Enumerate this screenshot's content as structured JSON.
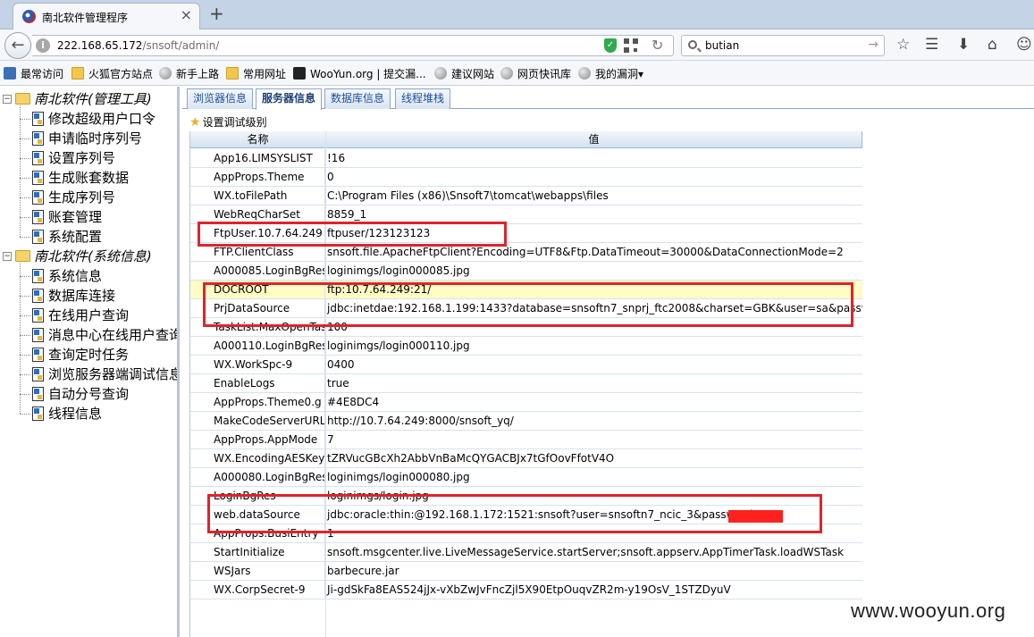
{
  "browser": {
    "tab_title": "南北软件管理程序",
    "tab_close": "×",
    "new_tab": "+",
    "url_host": "222.168.65.172",
    "url_path": "/snsoft/admin/",
    "search_value": "butian"
  },
  "bookmarks": [
    {
      "label": "最常访问",
      "icon": "bookmarks-icon"
    },
    {
      "label": "火狐官方站点",
      "icon": "folder-icon"
    },
    {
      "label": "新手上路",
      "icon": "globe-icon"
    },
    {
      "label": "常用网址",
      "icon": "folder-icon"
    },
    {
      "label": "WooYun.org | 提交漏...",
      "icon": "wooyun-icon"
    },
    {
      "label": "建议网站",
      "icon": "globe-icon"
    },
    {
      "label": "网页快讯库",
      "icon": "globe-icon"
    },
    {
      "label": "我的漏洞▾",
      "icon": "globe-icon"
    }
  ],
  "tree": {
    "group1": {
      "label": "南北软件(管理工具)",
      "items": [
        "修改超级用户口令",
        "申请临时序列号",
        "设置序列号",
        "生成账套数据",
        "生成序列号",
        "账套管理",
        "系统配置"
      ]
    },
    "group2": {
      "label": "南北软件(系统信息)",
      "items": [
        "系统信息",
        "数据库连接",
        "在线用户查询",
        "消息中心在线用户查询",
        "查询定时任务",
        "浏览服务器端调试信息",
        "自动分号查询",
        "线程信息"
      ]
    }
  },
  "subtabs": [
    "浏览器信息",
    "服务器信息",
    "数据库信息",
    "线程堆栈"
  ],
  "debug_label": "设置调试级别",
  "grid": {
    "headers": {
      "name": "名称",
      "value": "值"
    },
    "rows": [
      {
        "name": "App16.LIMSYSLIST",
        "value": "!16"
      },
      {
        "name": "AppProps.Theme",
        "value": "0"
      },
      {
        "name": "WX.toFilePath",
        "value": "C:\\Program Files (x86)\\Snsoft7\\tomcat\\webapps\\files"
      },
      {
        "name": "WebReqCharSet",
        "value": "8859_1"
      },
      {
        "name": "FtpUser.10.7.64.249",
        "value": "ftpuser/123123123"
      },
      {
        "name": "FTP.ClientClass",
        "value": "snsoft.file.ApacheFtpClient?Encoding=UTF8&Ftp.DataTimeout=30000&DataConnectionMode=2"
      },
      {
        "name": "A000085.LoginBgRes",
        "value": "loginimgs/login000085.jpg"
      },
      {
        "name": "DOCROOT",
        "value": "ftp:10.7.64.249:21/"
      },
      {
        "name": "PrjDataSource",
        "value": "jdbc:inetdae:192.168.1.199:1433?database=snsoftn7_snprj_ftc2008&charset=GBK&user=sa&password=s"
      },
      {
        "name": "TaskList.MaxOpenTasks",
        "value": "100"
      },
      {
        "name": "A000110.LoginBgRes",
        "value": "loginimgs/login000110.jpg"
      },
      {
        "name": "WX.WorkSpc-9",
        "value": "0400"
      },
      {
        "name": "EnableLogs",
        "value": "true"
      },
      {
        "name": "AppProps.Theme0.g",
        "value": "#4E8DC4"
      },
      {
        "name": "MakeCodeServerURL",
        "value": "http://10.7.64.249:8000/snsoft_yq/"
      },
      {
        "name": "AppProps.AppMode",
        "value": "7"
      },
      {
        "name": "WX.EncodingAESKey",
        "value": "tZRVucGBcXh2AbbVnBaMcQYGACBJx7tGfOovFfotV4O"
      },
      {
        "name": "A000080.LoginBgRes",
        "value": "loginimgs/login000080.jpg"
      },
      {
        "name": "LoginBgRes",
        "value": "loginimgs/login.jpg"
      },
      {
        "name": "web.dataSource",
        "value": "jdbc:oracle:thin:@192.168.1.172:1521:snsoft?user=snsoftn7_ncic_3&password="
      },
      {
        "name": "AppProps.BusiEntry",
        "value": "1"
      },
      {
        "name": "StartInitialize",
        "value": "snsoft.msgcenter.live.LiveMessageService.startServer;snsoft.appserv.AppTimerTask.loadWSTask"
      },
      {
        "name": "WSJars",
        "value": "barbecure.jar"
      },
      {
        "name": "WX.CorpSecret-9",
        "value": "Ji-gdSkFa8EAS524jJx-vXbZwJvFncZjl5X90EtpOuqvZR2m-y19OsV_1STZDyuV"
      }
    ],
    "highlighted_row": 7
  },
  "watermark": "www.wooyun.org",
  "colors": {
    "accent": "#1f4f9a",
    "highlight_row": "#fffcc4",
    "annotation": "#e0232b"
  }
}
